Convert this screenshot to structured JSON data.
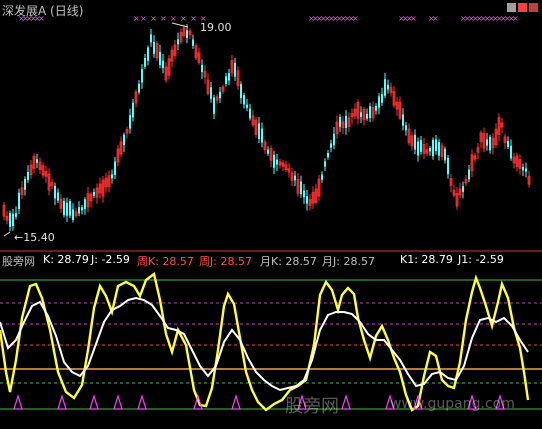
{
  "window": {
    "title": "深发展A (日线)"
  },
  "main_chart": {
    "high_label": "19.00",
    "low_label": "15.40",
    "markers_color": "#ff40ff"
  },
  "indicator": {
    "name": "股旁网",
    "k_label": "K: 28.79",
    "j_label": "J: -2.59",
    "week_k_label": "周K: 28.57",
    "week_j_label": "周J: 28.57",
    "month_k_label": "月K: 28.57",
    "month_j_label": "月J: 28.57",
    "k1_label": "K1: 28.79",
    "j1_label": "J1: -2.59"
  },
  "watermark": {
    "text": "股旁网",
    "url": "www.gupang.com"
  },
  "colors": {
    "up_candle": "#ff3030",
    "down_candle": "#54ffff",
    "k_line": "#ffffff",
    "j_line": "#ffff40",
    "level_green": "#40c040",
    "level_magenta": "#c040c0",
    "level_red": "#ff4040",
    "level_orange": "#ffa040"
  }
}
